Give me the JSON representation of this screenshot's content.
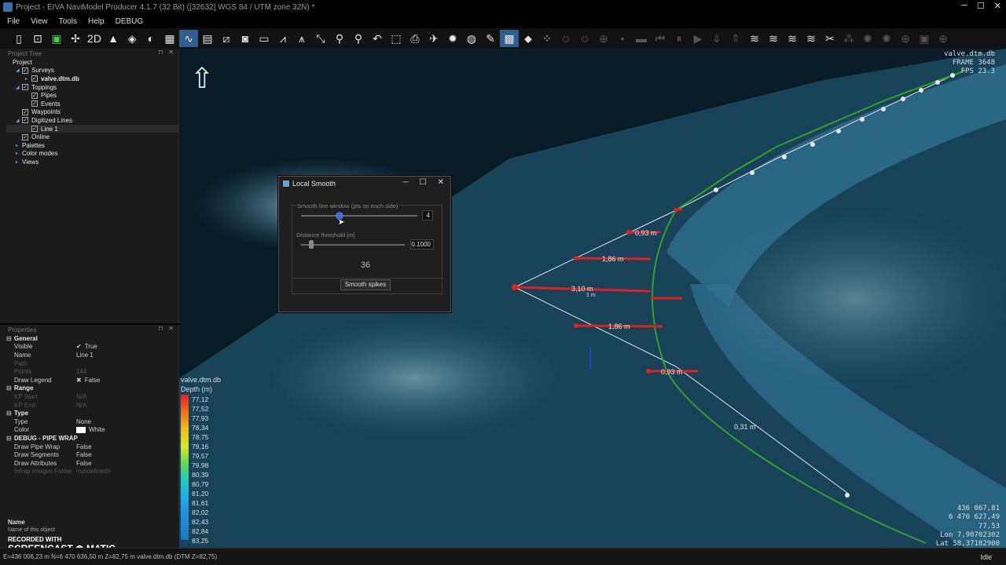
{
  "window": {
    "title": "Project - EIVA NaviModel Producer 4.1.7  (32 Bit) ([32632] WGS 84 / UTM zone 32N) *",
    "minimize": "─",
    "maximize": "☐",
    "close": "✕"
  },
  "menu": [
    "File",
    "View",
    "Tools",
    "Help",
    "DEBUG"
  ],
  "toolbar_icons": [
    {
      "name": "new-icon",
      "glyph": "▯"
    },
    {
      "name": "open-icon",
      "glyph": "⊡"
    },
    {
      "name": "save-icon",
      "glyph": "▣",
      "color": "#4cd04c"
    },
    {
      "name": "satellite-icon",
      "glyph": "✢"
    },
    {
      "name": "2d-icon",
      "glyph": "2D"
    },
    {
      "name": "navigate-icon",
      "glyph": "▲"
    },
    {
      "name": "3d-view-icon",
      "glyph": "◈"
    },
    {
      "name": "shaded-icon",
      "glyph": "◐"
    },
    {
      "name": "grid-icon",
      "glyph": "▦"
    },
    {
      "name": "line-icon",
      "glyph": "∿",
      "active": true
    },
    {
      "name": "raster-icon",
      "glyph": "▤"
    },
    {
      "name": "profile-icon",
      "glyph": "⧄"
    },
    {
      "name": "camera-icon",
      "glyph": "◙"
    },
    {
      "name": "ruler-icon",
      "glyph": "▭"
    },
    {
      "name": "wave-icon",
      "glyph": "⩘"
    },
    {
      "name": "chart-icon",
      "glyph": "⩚"
    },
    {
      "name": "cursor-icon",
      "glyph": "⤡"
    },
    {
      "name": "pin-icon",
      "glyph": "⚲"
    },
    {
      "name": "search-pin-icon",
      "glyph": "⚲"
    },
    {
      "name": "undo-icon",
      "glyph": "↶"
    },
    {
      "name": "select-icon",
      "glyph": "⬚"
    },
    {
      "name": "export-icon",
      "glyph": "⎙"
    },
    {
      "name": "plane-icon",
      "glyph": "✈"
    },
    {
      "name": "gear-icon",
      "glyph": "✹"
    },
    {
      "name": "palette-icon",
      "glyph": "◍"
    },
    {
      "name": "brush-icon",
      "glyph": "✎"
    },
    {
      "name": "fill-icon",
      "glyph": "▩",
      "active": true
    },
    {
      "name": "tag-icon",
      "glyph": "⬥"
    },
    {
      "name": "points-icon",
      "glyph": "⁘"
    },
    {
      "name": "face-icon",
      "glyph": "☺",
      "dim": true
    },
    {
      "name": "face2-icon",
      "glyph": "☺",
      "dim": true
    },
    {
      "name": "add-point-icon",
      "glyph": "⊕",
      "dim": true
    },
    {
      "name": "dot-icon",
      "glyph": "•",
      "dim": true
    },
    {
      "name": "film-icon",
      "glyph": "▬",
      "dim": true
    },
    {
      "name": "prev-icon",
      "glyph": "⏮",
      "dim": true
    },
    {
      "name": "pause-icon",
      "glyph": "⏸",
      "dim": true
    },
    {
      "name": "play-icon",
      "glyph": "▶",
      "dim": true
    },
    {
      "name": "down-icon",
      "glyph": "⇓",
      "dim": true
    },
    {
      "name": "up-icon",
      "glyph": "⇑",
      "dim": true
    },
    {
      "name": "smooth-icon",
      "glyph": "≋"
    },
    {
      "name": "smooth2-icon",
      "glyph": "≋"
    },
    {
      "name": "smooth3-icon",
      "glyph": "≋"
    },
    {
      "name": "smooth4-icon",
      "glyph": "≋"
    },
    {
      "name": "tools-icon",
      "glyph": "✂"
    },
    {
      "name": "xyz-icon",
      "glyph": "⁂",
      "dim": true
    },
    {
      "name": "dim1-icon",
      "glyph": "✺",
      "dim": true
    },
    {
      "name": "dim2-icon",
      "glyph": "✺",
      "dim": true
    },
    {
      "name": "dim3-icon",
      "glyph": "⊕",
      "dim": true
    },
    {
      "name": "dim4-icon",
      "glyph": "▣",
      "dim": true
    },
    {
      "name": "dim5-icon",
      "glyph": "⊕",
      "dim": true
    }
  ],
  "project_tree": {
    "header": "Project Tree",
    "pin": "⊓",
    "close": "✕",
    "items": [
      {
        "label": "Project",
        "level": 0,
        "arrow": "",
        "check": false
      },
      {
        "label": "Surveys",
        "level": 1,
        "arrow": "◢",
        "check": true
      },
      {
        "label": "valve.dtm.db",
        "level": 2,
        "arrow": "▸",
        "check": true,
        "bold": true
      },
      {
        "label": "Toppings",
        "level": 1,
        "arrow": "◢",
        "check": true
      },
      {
        "label": "Pipes",
        "level": 2,
        "arrow": "",
        "check": true
      },
      {
        "label": "Events",
        "level": 2,
        "arrow": "",
        "check": true
      },
      {
        "label": "Waypoints",
        "level": 1,
        "arrow": "",
        "check": true
      },
      {
        "label": "Digitized Lines",
        "level": 1,
        "arrow": "◢",
        "check": true
      },
      {
        "label": "Line 1",
        "level": 2,
        "arrow": "",
        "check": true,
        "selected": true
      },
      {
        "label": "Online",
        "level": 1,
        "arrow": "",
        "check": true
      },
      {
        "label": "Palettes",
        "level": 1,
        "arrow": "▸",
        "check": false
      },
      {
        "label": "Color modes",
        "level": 1,
        "arrow": "▸",
        "check": false
      },
      {
        "label": "Views",
        "level": 1,
        "arrow": "▸",
        "check": false
      }
    ]
  },
  "properties": {
    "header": "Properties",
    "pin": "⊓",
    "close": "✕",
    "sections": [
      {
        "title": "General",
        "rows": [
          {
            "k": "Visible",
            "v": "True",
            "check": "✔"
          },
          {
            "k": "Name",
            "v": "Line 1"
          },
          {
            "k": "Path",
            "v": "",
            "dim": true
          },
          {
            "k": "Points",
            "v": "144",
            "dim": true
          },
          {
            "k": "Draw Legend",
            "v": "False",
            "check": "✖"
          }
        ]
      },
      {
        "title": "Range",
        "rows": [
          {
            "k": "KP Start",
            "v": "N/A",
            "dim": true
          },
          {
            "k": "KP End",
            "v": "N/A",
            "dim": true
          }
        ]
      },
      {
        "title": "Type",
        "rows": [
          {
            "k": "Type",
            "v": "None"
          },
          {
            "k": "Color",
            "v": "White",
            "swatch": "#ffffff"
          }
        ]
      },
      {
        "title": "DEBUG - PIPE WRAP",
        "rows": [
          {
            "k": "Draw Pipe Wrap",
            "v": "False"
          },
          {
            "k": "Draw Segments",
            "v": "False"
          },
          {
            "k": "Draw Attributes",
            "v": "False"
          },
          {
            "k": "Infrap Images Folder",
            "v": "<undefined>",
            "dim": true
          }
        ]
      }
    ],
    "collapse": "⊟"
  },
  "info": {
    "name_label": "Name",
    "name_desc": "Name of this object"
  },
  "watermark": {
    "line1": "RECORDED WITH",
    "line2a": "SCREENCAST",
    "line2b": "MATIC"
  },
  "dialog": {
    "title": "Local Smooth",
    "minimize": "─",
    "maximize": "☐",
    "close": "✕",
    "window_label": "Smooth line window (pts on each side)",
    "window_value": "4",
    "window_fraction": 0.33,
    "threshold_label": "Distance threshold [m]",
    "threshold_value": "0.1000",
    "threshold_fraction": 0.1,
    "count": "36",
    "button": "Smooth spikes"
  },
  "viewport": {
    "north_arrow": "⇧",
    "hud_top_right": [
      "valve.dtm.db",
      "FRAME 3648",
      "FPS 23.3"
    ],
    "hud_bottom_right": [
      "436 067,81",
      "6 470 627,49",
      "77,53",
      "Lon 7,90702302",
      "Lat 58,37182900"
    ],
    "labels": [
      {
        "text": "0,93 m"
      },
      {
        "text": "1,86 m"
      },
      {
        "text": "3,10 m"
      },
      {
        "text": "1 m"
      },
      {
        "text": "1,86 m"
      },
      {
        "text": "0,93 m"
      },
      {
        "text": "0,31 m"
      }
    ]
  },
  "legend": {
    "title": "valve.dtm.db",
    "subtitle": "Depth (m)",
    "values": [
      "77,12",
      "77,52",
      "77,93",
      "78,34",
      "78,75",
      "79,16",
      "79,57",
      "79,98",
      "80,39",
      "80,79",
      "81,20",
      "81,61",
      "82,02",
      "82,43",
      "82,84",
      "83,25"
    ]
  },
  "status": {
    "text": "E=436 006,23 m N=6 470 636,50 m Z=82,75 m valve.dtm.db (DTM Z=82,75)",
    "state": "Idle"
  }
}
